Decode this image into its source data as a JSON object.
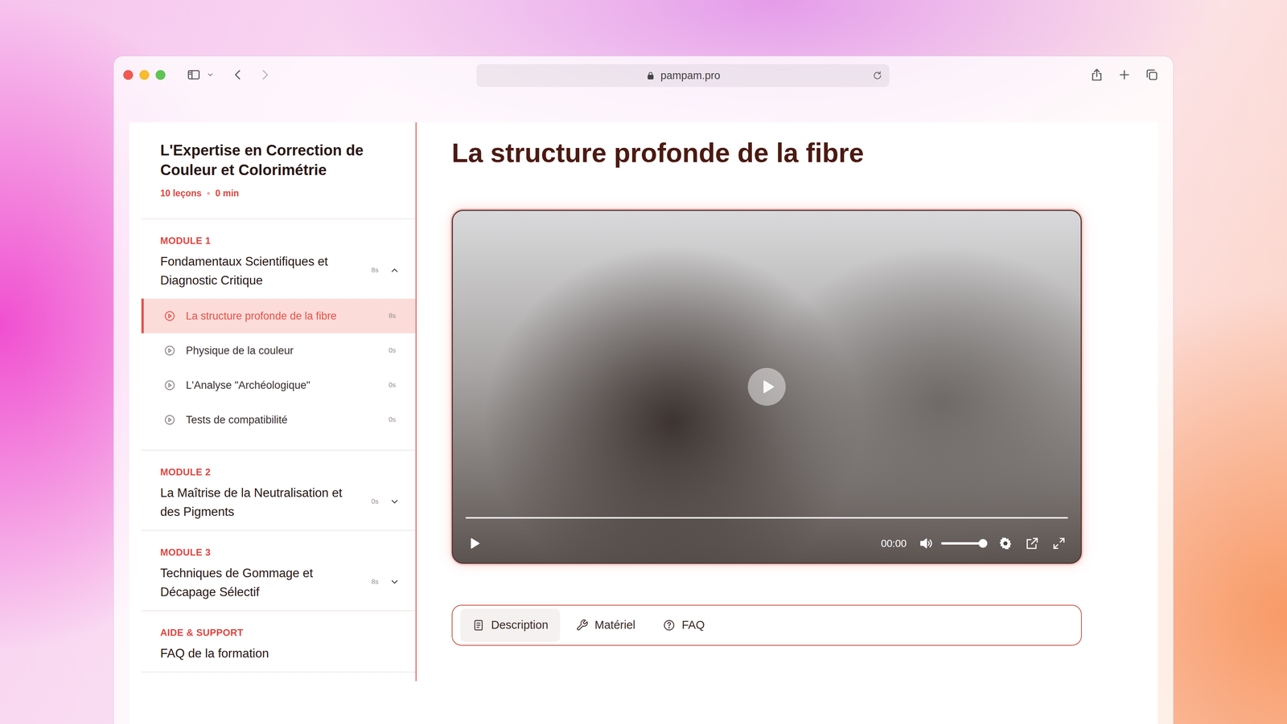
{
  "browser": {
    "url": "pampam.pro",
    "traffic_lights": [
      {
        "color": "#ee5a52"
      },
      {
        "color": "#f5bd2f"
      },
      {
        "color": "#5fc454"
      }
    ],
    "back_enabled": true,
    "forward_enabled": false
  },
  "course": {
    "title": "L'Expertise en Correction de Couleur et Colorimétrie",
    "lessons_count": "10 leçons",
    "duration": "0 min"
  },
  "modules": [
    {
      "label": "MODULE 1",
      "title": "Fondamentaux Scientifiques et Diagnostic Critique",
      "duration": "8s",
      "expanded": true,
      "lessons": [
        {
          "title": "La structure profonde de la fibre",
          "duration": "8s",
          "selected": true
        },
        {
          "title": "Physique de la couleur",
          "duration": "0s",
          "selected": false
        },
        {
          "title": "L'Analyse \"Archéologique\"",
          "duration": "0s",
          "selected": false
        },
        {
          "title": "Tests de compatibilité",
          "duration": "0s",
          "selected": false
        }
      ]
    },
    {
      "label": "MODULE 2",
      "title": "La Maîtrise de la Neutralisation et des Pigments",
      "duration": "0s",
      "expanded": false,
      "lessons": []
    },
    {
      "label": "MODULE 3",
      "title": "Techniques de Gommage et Décapage Sélectif",
      "duration": "8s",
      "expanded": false,
      "lessons": []
    }
  ],
  "support": {
    "label": "AIDE & SUPPORT",
    "title": "FAQ de la formation"
  },
  "lesson": {
    "title": "La structure profonde de la fibre"
  },
  "player": {
    "time": "00:00",
    "progress": 0,
    "volume": 0.93,
    "playing": false
  },
  "tabs": [
    {
      "label": "Description",
      "selected": true
    },
    {
      "label": "Matériel",
      "selected": false
    },
    {
      "label": "FAQ",
      "selected": false
    }
  ]
}
